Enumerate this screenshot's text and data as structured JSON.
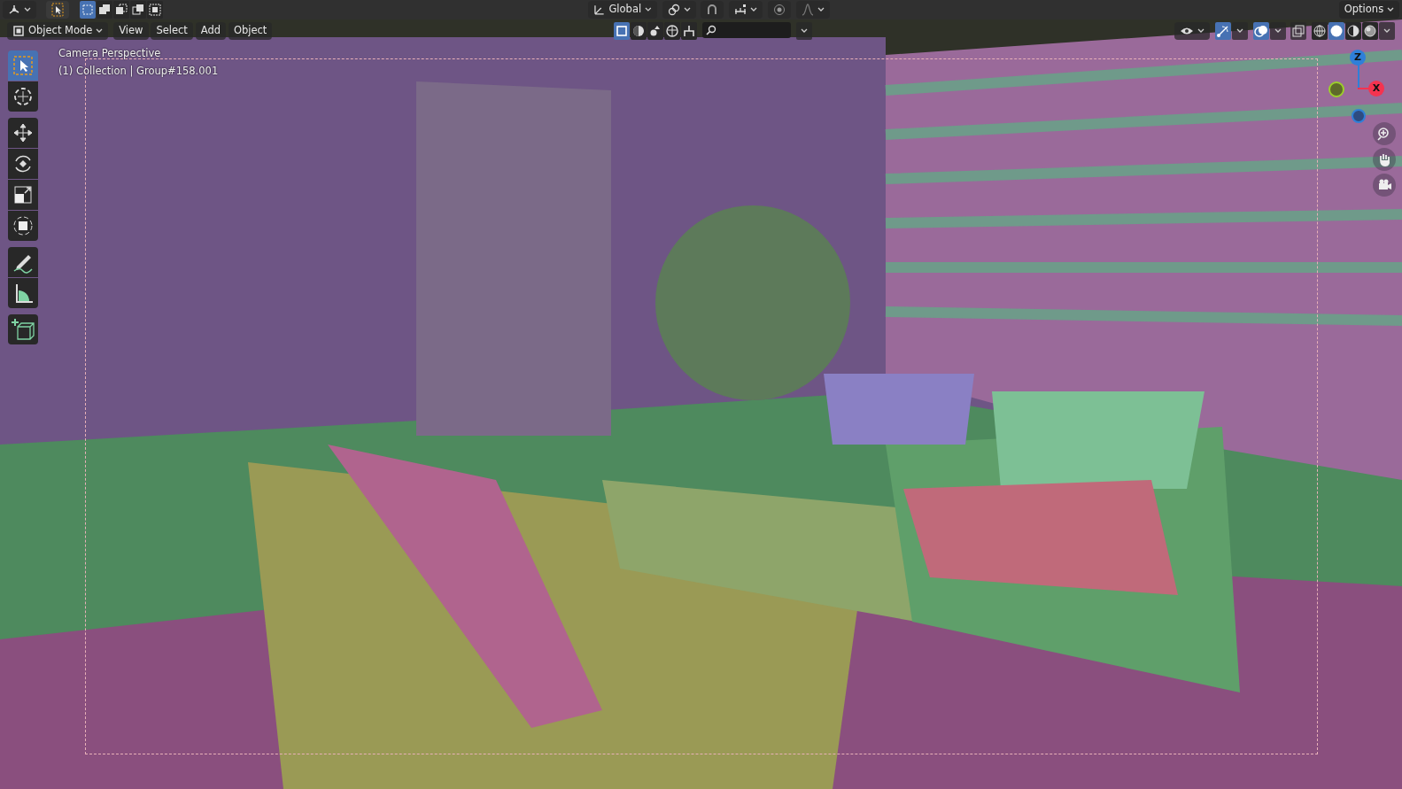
{
  "top_bar": {
    "select_modes": [
      {
        "selected": true
      },
      {
        "selected": false
      },
      {
        "selected": false
      },
      {
        "selected": false
      },
      {
        "selected": false
      }
    ],
    "orientation": "Global",
    "proportional_editing": {
      "on": false
    },
    "options": "Options"
  },
  "header": {
    "mode": "Object Mode",
    "menus": [
      "View",
      "Select",
      "Add",
      "Object"
    ],
    "collection_filters": [
      {
        "selected": true
      },
      {
        "selected": false
      },
      {
        "selected": false
      },
      {
        "selected": false
      },
      {
        "selected": false
      }
    ],
    "gizmos": {
      "on": true
    },
    "overlays": {
      "on": true
    },
    "xray": {
      "on": false
    },
    "shading": [
      {
        "kind": "wireframe",
        "selected": false
      },
      {
        "kind": "solid",
        "selected": true
      },
      {
        "kind": "material",
        "selected": false
      },
      {
        "kind": "rendered",
        "selected": false
      }
    ]
  },
  "viewport": {
    "view_name": "Camera Perspective",
    "object_info": "(1) Collection | Group#158.001"
  },
  "toolbar": [
    {
      "kind": "select",
      "selected": true
    },
    {
      "kind": "cursor",
      "selected": false
    },
    {
      "kind": "move",
      "selected": false
    },
    {
      "kind": "rotate",
      "selected": false
    },
    {
      "kind": "scale",
      "selected": false
    },
    {
      "kind": "transform",
      "selected": false
    },
    {
      "kind": "annotate",
      "selected": false
    },
    {
      "kind": "measure",
      "selected": false
    },
    {
      "kind": "add_cube",
      "selected": false
    }
  ],
  "navigation_gizmo": {
    "axes": [
      {
        "label": "Z",
        "color": "#2f7fd8"
      },
      {
        "label": "X",
        "color": "#f5334f"
      }
    ]
  }
}
